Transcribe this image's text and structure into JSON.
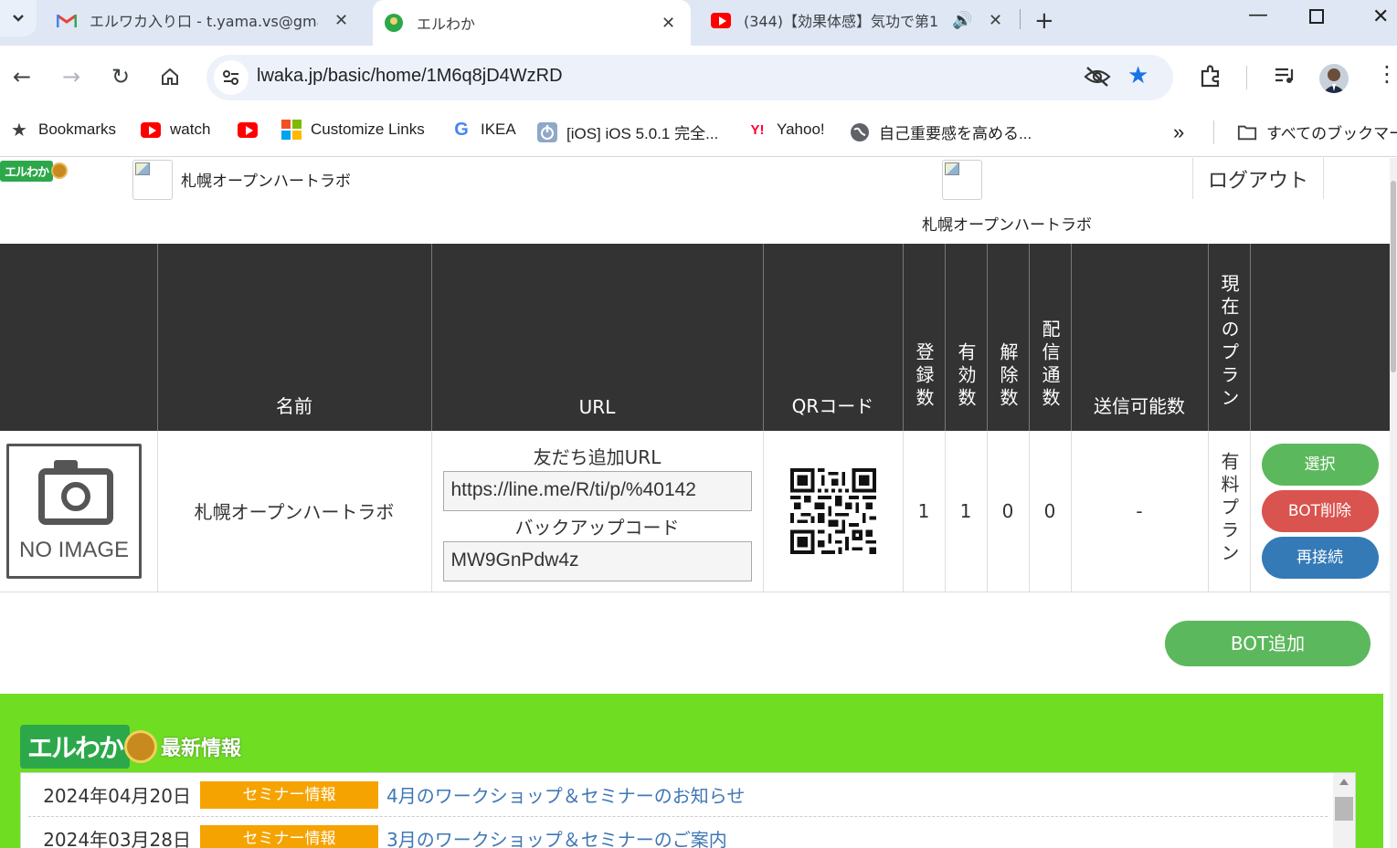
{
  "browser": {
    "tabs": [
      {
        "title": "エルワカ入り口 - t.yama.vs@gmai",
        "icon": "gmail-icon"
      },
      {
        "title": "エルわか",
        "icon": "elwaka-icon",
        "active": true
      },
      {
        "title": "(344)【効果体感】気功で第1",
        "icon": "youtube-icon"
      }
    ],
    "address": "lwaka.jp/basic/home/1M6q8jD4WzRD",
    "bookmarks": [
      {
        "label": "Bookmarks",
        "icon": "star-icon"
      },
      {
        "label": "watch",
        "icon": "youtube-icon"
      },
      {
        "label": "",
        "icon": "youtube-icon"
      },
      {
        "label": "Customize Links",
        "icon": "windows-icon"
      },
      {
        "label": "IKEA",
        "icon": "google-icon"
      },
      {
        "label": "[iOS] iOS 5.0.1 完全...",
        "icon": "power-icon"
      },
      {
        "label": "Yahoo!",
        "icon": "yahoo-icon"
      },
      {
        "label": "自己重要感を高める...",
        "icon": "globe-icon"
      }
    ],
    "more_bookmarks": "»",
    "all_bookmarks": "すべてのブックマーク"
  },
  "header": {
    "account_name_left": "札幌オープンハートラボ",
    "account_name_right": "札幌オープンハートラボ",
    "logout": "ログアウト"
  },
  "table": {
    "headers": {
      "name": "名前",
      "url": "URL",
      "qr": "QRコード",
      "registered": "登録数",
      "valid": "有効数",
      "unsub": "解除数",
      "sent": "配信通数",
      "sendable": "送信可能数",
      "plan": "現在のプラン"
    },
    "row": {
      "no_image": "NO IMAGE",
      "name": "札幌オープンハートラボ",
      "friend_url_label": "友だち追加URL",
      "friend_url": "https://line.me/R/ti/p/%40142",
      "backup_label": "バックアップコード",
      "backup_code": "MW9GnPdw4z",
      "registered": "1",
      "valid": "1",
      "unsub": "0",
      "sent": "0",
      "sendable": "-",
      "plan": "有料プラン",
      "select_btn": "選択",
      "delete_btn": "BOT削除",
      "reconnect_btn": "再接続"
    }
  },
  "add_bot": "BOT追加",
  "news": {
    "logo_text": "エルわか",
    "title": "最新情報",
    "items": [
      {
        "date": "2024年04月20日",
        "badge": "セミナー情報",
        "text": "4月のワークショップ＆セミナーのお知らせ"
      },
      {
        "date": "2024年03月28日",
        "badge": "セミナー情報",
        "text": "3月のワークショップ＆セミナーのご案内"
      }
    ]
  },
  "colors": {
    "header_bg": "#333333",
    "news_bg": "#6fdd22",
    "badge": "#f5a300",
    "green_btn": "#5cb85c",
    "red_btn": "#d9534f",
    "blue_btn": "#337ab7",
    "link": "#3f77b5"
  }
}
